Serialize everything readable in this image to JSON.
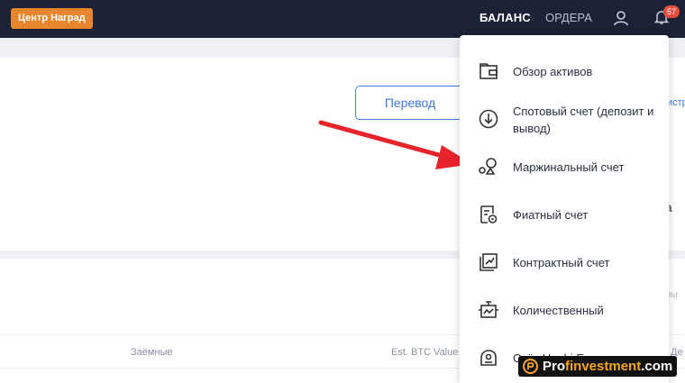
{
  "header": {
    "reward_center": "Центр Наград",
    "nav_balance": "БАЛАНС",
    "nav_orders": "ОРДЕРА",
    "notifications_count": "57"
  },
  "main": {
    "transfer_button": "Перевод",
    "partial_right_link": "истр",
    "partial_right_a": "а",
    "partial_right_gray": "ры",
    "table_headers": [
      "Заёмные",
      "Est. BTC Value",
      "Де"
    ]
  },
  "dropdown": {
    "items": [
      {
        "label": "Обзор активов",
        "icon": "wallet-icon"
      },
      {
        "label": "Спотовый счет (депозит и вывод)",
        "icon": "download-circle-icon"
      },
      {
        "label": "Маржинальный счет",
        "icon": "margin-balance-icon"
      },
      {
        "label": "Фиатный счет",
        "icon": "fiat-doc-icon"
      },
      {
        "label": "Контрактный счет",
        "icon": "contract-chart-icon"
      },
      {
        "label": "Количественный",
        "icon": "quant-bot-icon"
      },
      {
        "label": "Счёт Huobi Earn",
        "icon": "earn-icon"
      }
    ]
  },
  "watermark": {
    "prefix": "Pro",
    "middle": "finvestment",
    "suffix": ".com"
  },
  "colors": {
    "topbar": "#1b2236",
    "accent_blue": "#3e7be2",
    "reward_orange": "#e8862d",
    "badge_red": "#e74c3c",
    "arrow_red": "#e8242b"
  }
}
